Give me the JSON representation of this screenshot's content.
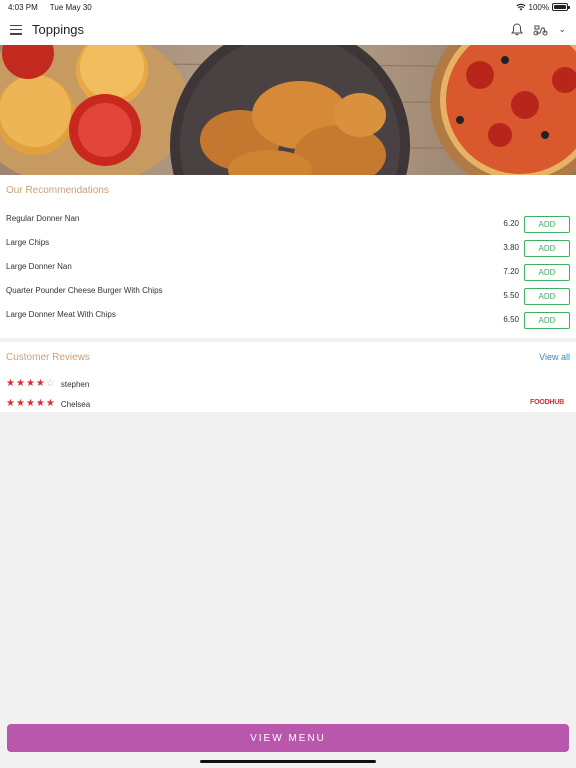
{
  "status_bar": {
    "time": "4:03 PM",
    "date": "Tue May 30",
    "battery": "100%"
  },
  "header": {
    "title": "Toppings",
    "icons": [
      "menu-icon",
      "bell-icon",
      "scooter-icon",
      "chevron-down-icon"
    ]
  },
  "recommendations": {
    "title": "Our Recommendations",
    "items": [
      {
        "name": "Regular Donner Nan",
        "price": "6.20",
        "add_label": "ADD"
      },
      {
        "name": "Large Chips",
        "price": "3.80",
        "add_label": "ADD"
      },
      {
        "name": "Large Donner Nan",
        "price": "7.20",
        "add_label": "ADD"
      },
      {
        "name": "Quarter Pounder Cheese Burger With Chips",
        "price": "5.50",
        "add_label": "ADD"
      },
      {
        "name": "Large Donner Meat With Chips",
        "price": "6.50",
        "add_label": "ADD"
      }
    ]
  },
  "reviews": {
    "title": "Customer Reviews",
    "view_all": "View all",
    "items": [
      {
        "name": "stephen",
        "rating": 4
      },
      {
        "name": "Chelsea",
        "rating": 5
      }
    ],
    "logo_text": "FOODHUB"
  },
  "footer": {
    "view_menu": "VIEW MENU"
  },
  "colors": {
    "accent": "#b957ac",
    "add_green": "#3fae63",
    "section_title": "#c8a27a",
    "star": "#d92c35",
    "link": "#2a8fc4"
  }
}
